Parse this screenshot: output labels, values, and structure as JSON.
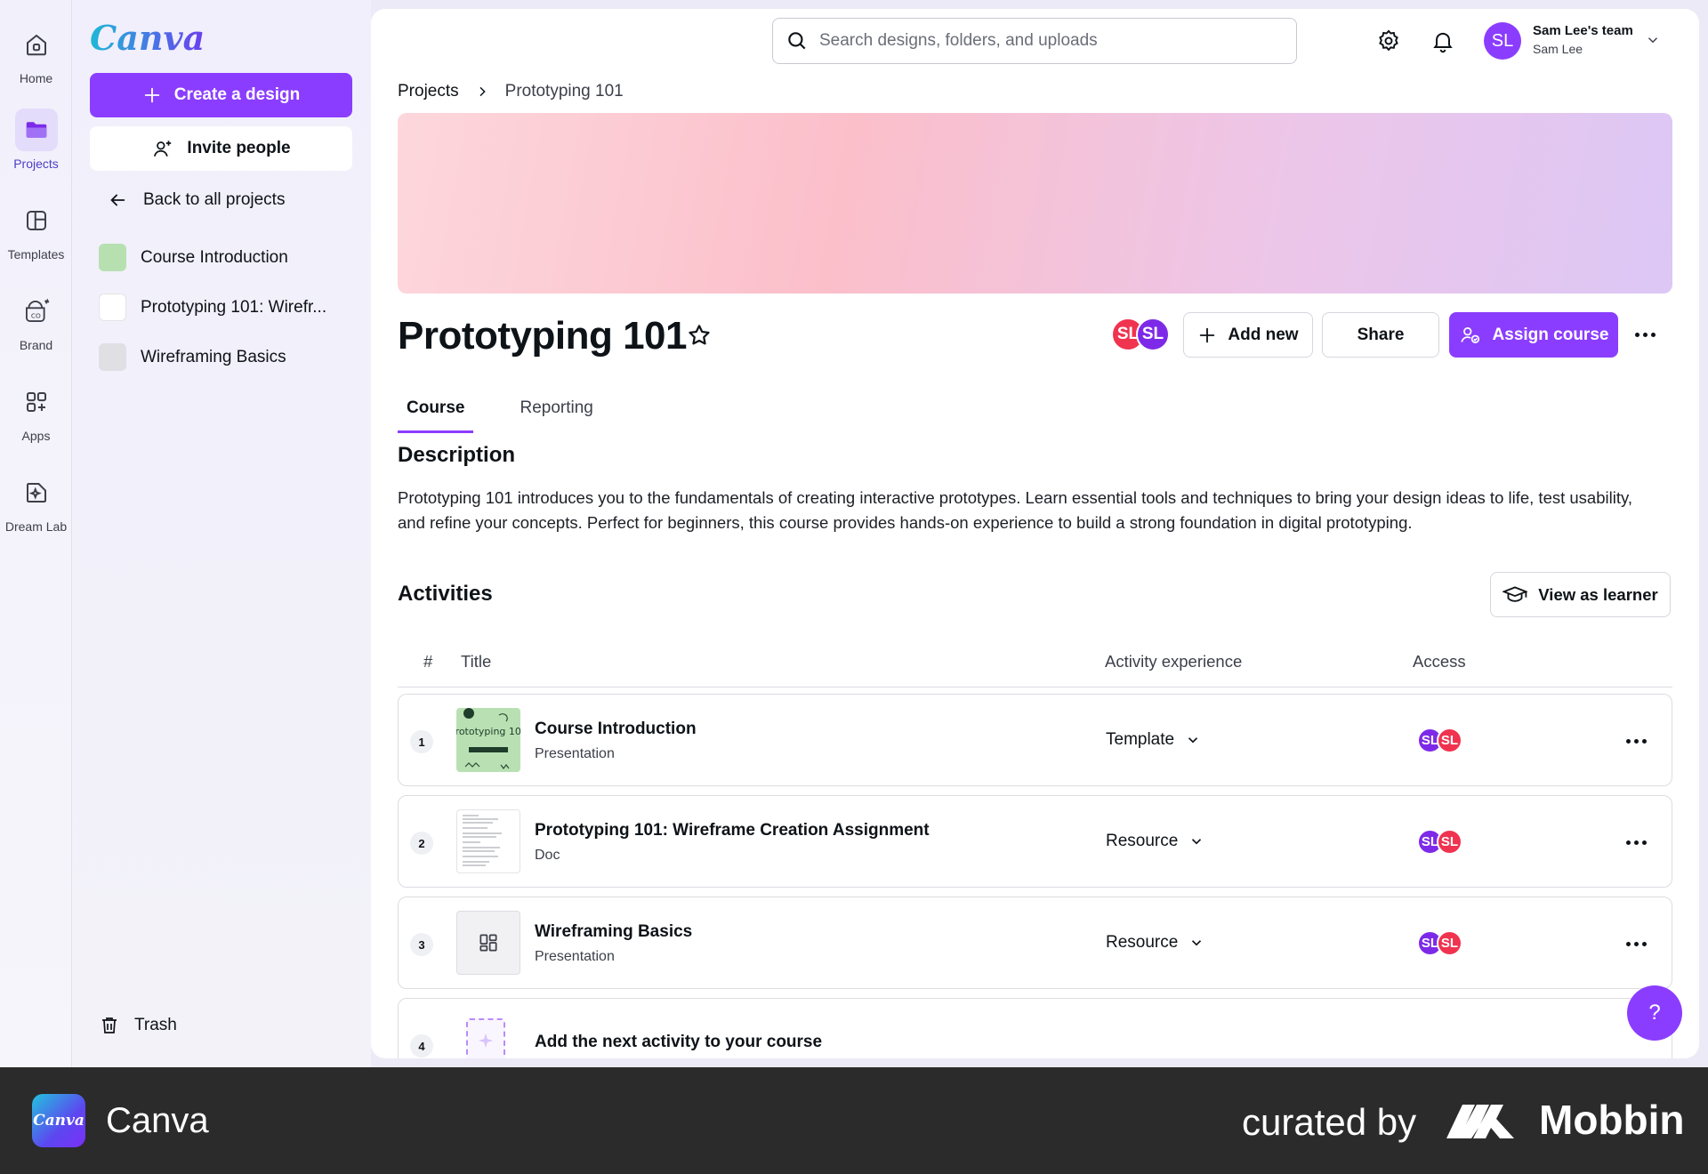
{
  "rail": {
    "items": [
      {
        "label": "Home",
        "icon": "home-icon"
      },
      {
        "label": "Projects",
        "icon": "folder-icon"
      },
      {
        "label": "Templates",
        "icon": "templates-icon"
      },
      {
        "label": "Brand",
        "icon": "brand-icon"
      },
      {
        "label": "Apps",
        "icon": "apps-icon"
      },
      {
        "label": "Dream Lab",
        "icon": "dream-lab-icon"
      }
    ]
  },
  "sidebar": {
    "logo": "Canva",
    "create_label": "Create a design",
    "invite_label": "Invite people",
    "back_label": "Back to all projects",
    "projects": [
      {
        "label": "Course Introduction"
      },
      {
        "label": "Prototyping 101: Wirefr..."
      },
      {
        "label": "Wireframing Basics"
      }
    ],
    "trash_label": "Trash"
  },
  "header": {
    "search_placeholder": "Search designs, folders, and uploads",
    "avatar_initials": "SL",
    "team_name": "Sam Lee's team",
    "user_name": "Sam Lee"
  },
  "breadcrumb": {
    "root": "Projects",
    "current": "Prototyping 101"
  },
  "project": {
    "title": "Prototyping 101",
    "collab_initials": [
      "SL",
      "SL"
    ],
    "add_new_label": "Add new",
    "share_label": "Share",
    "assign_label": "Assign course",
    "tabs": [
      {
        "label": "Course",
        "active": true
      },
      {
        "label": "Reporting",
        "active": false
      }
    ],
    "description_heading": "Description",
    "description": "Prototyping 101 introduces you to the fundamentals of creating interactive prototypes. Learn essential tools and techniques to bring your design ideas to life, test usability, and refine your concepts. Perfect for beginners, this course provides hands-on experience to build a strong foundation in digital prototyping.",
    "activities_heading": "Activities",
    "view_learner_label": "View as learner"
  },
  "table": {
    "headers": {
      "num": "#",
      "title": "Title",
      "experience": "Activity experience",
      "access": "Access"
    },
    "rows": [
      {
        "num": "1",
        "title": "Course Introduction",
        "type": "Presentation",
        "experience": "Template",
        "access": [
          "SL",
          "SL"
        ],
        "thumb_text": "Prototyping 101"
      },
      {
        "num": "2",
        "title": "Prototyping 101: Wireframe Creation Assignment",
        "type": "Doc",
        "experience": "Resource",
        "access": [
          "SL",
          "SL"
        ]
      },
      {
        "num": "3",
        "title": "Wireframing Basics",
        "type": "Presentation",
        "experience": "Resource",
        "access": [
          "SL",
          "SL"
        ]
      }
    ],
    "add_row": {
      "num": "4",
      "label": "Add the next activity to your course"
    }
  },
  "help_label": "?",
  "footer": {
    "app_logo_text": "Canva",
    "app_name": "Canva",
    "curated_by": "curated by",
    "brand": "Mobbin"
  },
  "colors": {
    "accent": "#8b3dff",
    "avatar_red": "#f0334f",
    "avatar_purple": "#7d2ae8"
  }
}
